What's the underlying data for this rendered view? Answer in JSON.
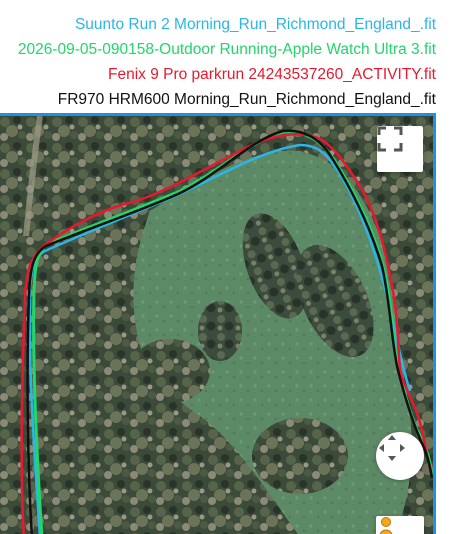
{
  "legend": {
    "items": [
      {
        "label": "Suunto Run 2 Morning_Run_Richmond_England_.fit",
        "color": "#29b6e8"
      },
      {
        "label": "2026-09-05-090158-Outdoor Running-Apple Watch Ultra 3.fit",
        "color": "#22d66a"
      },
      {
        "label": "Fenix 9 Pro parkrun 24243537260_ACTIVITY.fit",
        "color": "#e8182e"
      },
      {
        "label": "FR970 HRM600 Morning_Run_Richmond_England_.fit",
        "color": "#111111"
      }
    ]
  },
  "map": {
    "base_layer": "satellite",
    "frame_color": "#1e90e6",
    "controls": {
      "fullscreen_icon": "fullscreen-icon",
      "pan_icon": "pan-arrows-icon",
      "pegman_icon": "pegman-icon"
    }
  }
}
